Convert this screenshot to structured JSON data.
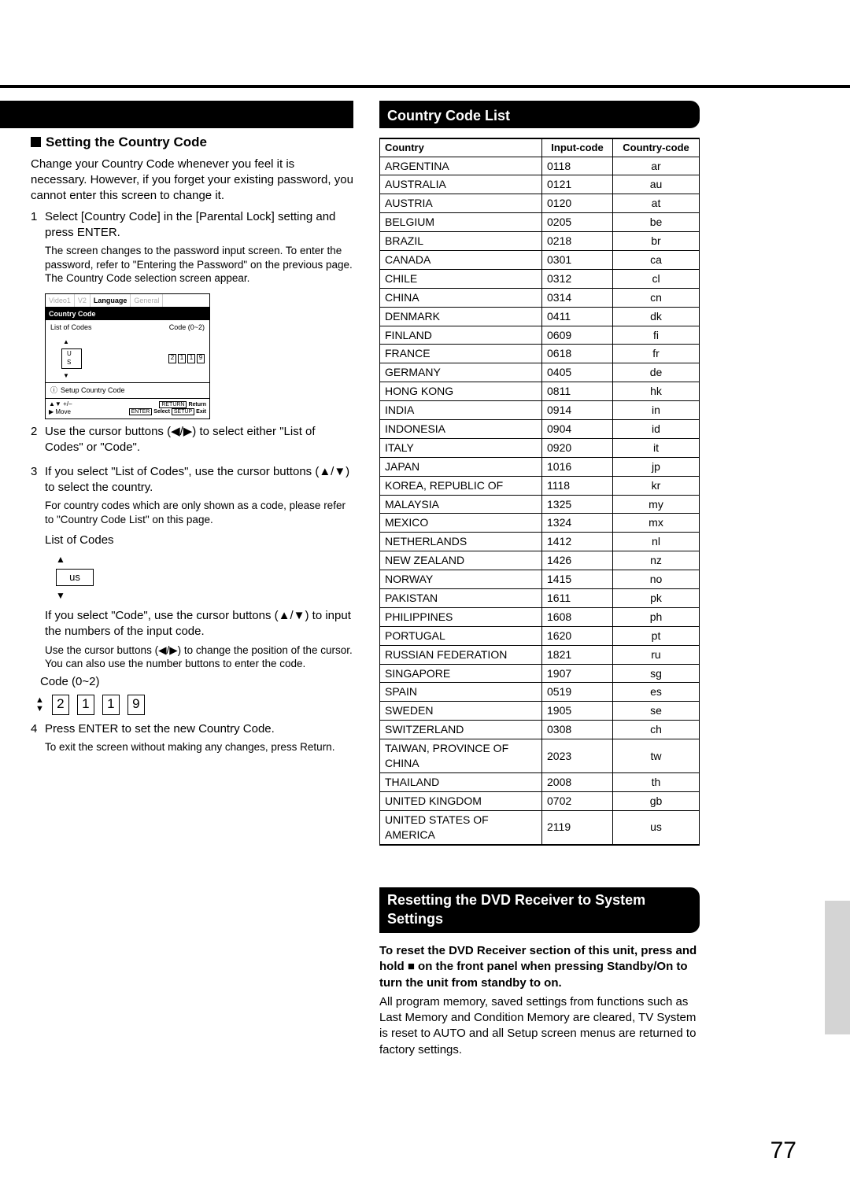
{
  "page_number": "77",
  "heading_left": "Setting the Country Code",
  "heading_right_1": "Country Code List",
  "heading_right_2": "Resetting the DVD Receiver to System Settings",
  "intro": "Change your Country Code whenever you feel it is necessary. However, if you forget your existing password, you cannot enter this screen to change it.",
  "step1": "Select [Country Code] in the [Parental Lock] setting and press ENTER.",
  "step1_note": "The screen changes to the password input screen. To enter the password, refer to \"Entering the Password\" on the previous page. The Country Code selection screen appear.",
  "osd": {
    "tabs": [
      "Video1",
      "V2",
      "Language",
      "General"
    ],
    "cc_label": "Country Code",
    "list_label": "List of Codes",
    "code_label": "Code (0~2)",
    "us": "U S",
    "digits": [
      "2",
      "1",
      "1",
      "9"
    ],
    "setup_label": "Setup Country Code",
    "plus_minus": "+/–",
    "move": "Move",
    "return": "Return",
    "enter": "ENTER",
    "select": "Select",
    "setup_btn": "SETUP",
    "exit": "Exit",
    "return_btn": "RETURN"
  },
  "step2": "Use the cursor buttons (◀/▶) to select either \"List of Codes\" or \"Code\".",
  "step3": "If you select \"List of Codes\", use the cursor buttons (▲/▼) to select the country.",
  "step3_note": "For country codes which are only shown as a code, please refer to \"Country Code List\" on this page.",
  "loc_title": "List of Codes",
  "loc_value": "us",
  "code_p1": "If you select \"Code\", use the cursor buttons (▲/▼) to input the numbers of the input code.",
  "code_p2": "Use the cursor buttons (◀/▶) to change the position of the cursor. You can also use the number buttons to enter the code.",
  "code_title": "Code  (0~2)",
  "code_digits": [
    "2",
    "1",
    "1",
    "9"
  ],
  "step4": "Press ENTER to set the new Country Code.",
  "step4_note": "To exit the screen without making any changes, press Return.",
  "table_headers": [
    "Country",
    "Input-code",
    "Country-code"
  ],
  "countries": [
    {
      "n": "ARGENTINA",
      "i": "0118",
      "c": "ar"
    },
    {
      "n": "AUSTRALIA",
      "i": "0121",
      "c": "au"
    },
    {
      "n": "AUSTRIA",
      "i": "0120",
      "c": "at"
    },
    {
      "n": "BELGIUM",
      "i": "0205",
      "c": "be"
    },
    {
      "n": "BRAZIL",
      "i": "0218",
      "c": "br"
    },
    {
      "n": "CANADA",
      "i": "0301",
      "c": "ca"
    },
    {
      "n": "CHILE",
      "i": "0312",
      "c": "cl"
    },
    {
      "n": "CHINA",
      "i": "0314",
      "c": "cn"
    },
    {
      "n": "DENMARK",
      "i": "0411",
      "c": "dk"
    },
    {
      "n": "FINLAND",
      "i": "0609",
      "c": "fi"
    },
    {
      "n": "FRANCE",
      "i": "0618",
      "c": "fr"
    },
    {
      "n": "GERMANY",
      "i": "0405",
      "c": "de"
    },
    {
      "n": "HONG KONG",
      "i": "0811",
      "c": "hk"
    },
    {
      "n": "INDIA",
      "i": "0914",
      "c": "in"
    },
    {
      "n": "INDONESIA",
      "i": "0904",
      "c": "id"
    },
    {
      "n": "ITALY",
      "i": "0920",
      "c": "it"
    },
    {
      "n": "JAPAN",
      "i": "1016",
      "c": "jp"
    },
    {
      "n": "KOREA, REPUBLIC OF",
      "i": "1118",
      "c": "kr"
    },
    {
      "n": "MALAYSIA",
      "i": "1325",
      "c": "my"
    },
    {
      "n": "MEXICO",
      "i": "1324",
      "c": "mx"
    },
    {
      "n": "NETHERLANDS",
      "i": "1412",
      "c": "nl"
    },
    {
      "n": "NEW ZEALAND",
      "i": "1426",
      "c": "nz"
    },
    {
      "n": "NORWAY",
      "i": "1415",
      "c": "no"
    },
    {
      "n": "PAKISTAN",
      "i": "1611",
      "c": "pk"
    },
    {
      "n": "PHILIPPINES",
      "i": "1608",
      "c": "ph"
    },
    {
      "n": "PORTUGAL",
      "i": "1620",
      "c": "pt"
    },
    {
      "n": "RUSSIAN FEDERATION",
      "i": "1821",
      "c": "ru"
    },
    {
      "n": "SINGAPORE",
      "i": "1907",
      "c": "sg"
    },
    {
      "n": "SPAIN",
      "i": "0519",
      "c": "es"
    },
    {
      "n": "SWEDEN",
      "i": "1905",
      "c": "se"
    },
    {
      "n": "SWITZERLAND",
      "i": "0308",
      "c": "ch"
    },
    {
      "n": "TAIWAN, PROVINCE OF CHINA",
      "i": "2023",
      "c": "tw"
    },
    {
      "n": "THAILAND",
      "i": "2008",
      "c": "th"
    },
    {
      "n": "UNITED KINGDOM",
      "i": "0702",
      "c": "gb"
    },
    {
      "n": "UNITED STATES OF AMERICA",
      "i": "2119",
      "c": "us"
    }
  ],
  "reset_bold": "To reset the DVD Receiver section of this unit, press and hold ■ on the front panel when pressing Standby/On to turn the unit from standby to on.",
  "reset_body": "All program memory, saved settings from functions such as Last Memory and Condition Memory are cleared, TV System is reset to AUTO and all Setup screen menus are returned to factory settings."
}
